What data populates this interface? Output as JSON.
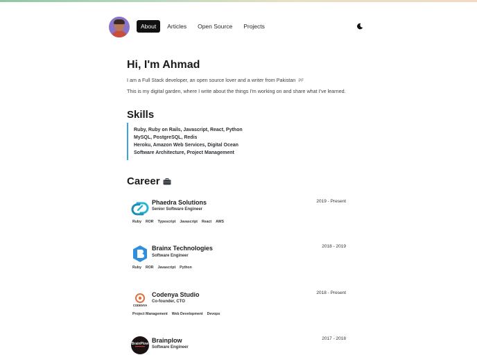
{
  "nav": {
    "items": [
      {
        "label": "About",
        "active": true
      },
      {
        "label": "Articles",
        "active": false
      },
      {
        "label": "Open Source",
        "active": false
      },
      {
        "label": "Projects",
        "active": false
      }
    ],
    "theme_toggle_icon": "moon-icon"
  },
  "hero": {
    "title": "Hi, I'm Ahmad",
    "line1": "I am a Full Stack developer, an open source lover and a writer from Pakistan",
    "flag": "PF",
    "line2": "This is my digital garden, where I write about the things I'm working on and share what I've learned."
  },
  "skills": {
    "title": "Skills",
    "lines": [
      "Ruby, Ruby on Rails, Javascript, React, Python",
      "MySQL, PostgreSQL, Redis",
      "Heroku, Amazon Web Services, Digital Ocean",
      "Software Architecture, Project Management"
    ],
    "accent_color": "#3aa3e3"
  },
  "career": {
    "title": "Career",
    "title_icon": "briefcase-icon",
    "jobs": [
      {
        "company": "Phaedra Solutions",
        "role": "Senior Software Engineer",
        "dates": "2019 - Present",
        "tags": [
          "Ruby",
          "ROR",
          "Typescript",
          "Javascript",
          "React",
          "AWS"
        ]
      },
      {
        "company": "Brainx Technologies",
        "role": "Software Engineer",
        "dates": "2018 - 2019",
        "tags": [
          "Ruby",
          "ROR",
          "Javascript",
          "Python"
        ]
      },
      {
        "company": "Codenya Studio",
        "role": "Co-founder, CTO",
        "dates": "2018 - Present",
        "logo_text": "CODENYA",
        "tags": [
          "Project Management",
          "Web Development",
          "Devops"
        ]
      },
      {
        "company": "Brainplow",
        "role": "Software Engineer",
        "dates": "2017 - 2018",
        "logo_text": "BrainPlow",
        "tags": []
      }
    ]
  }
}
